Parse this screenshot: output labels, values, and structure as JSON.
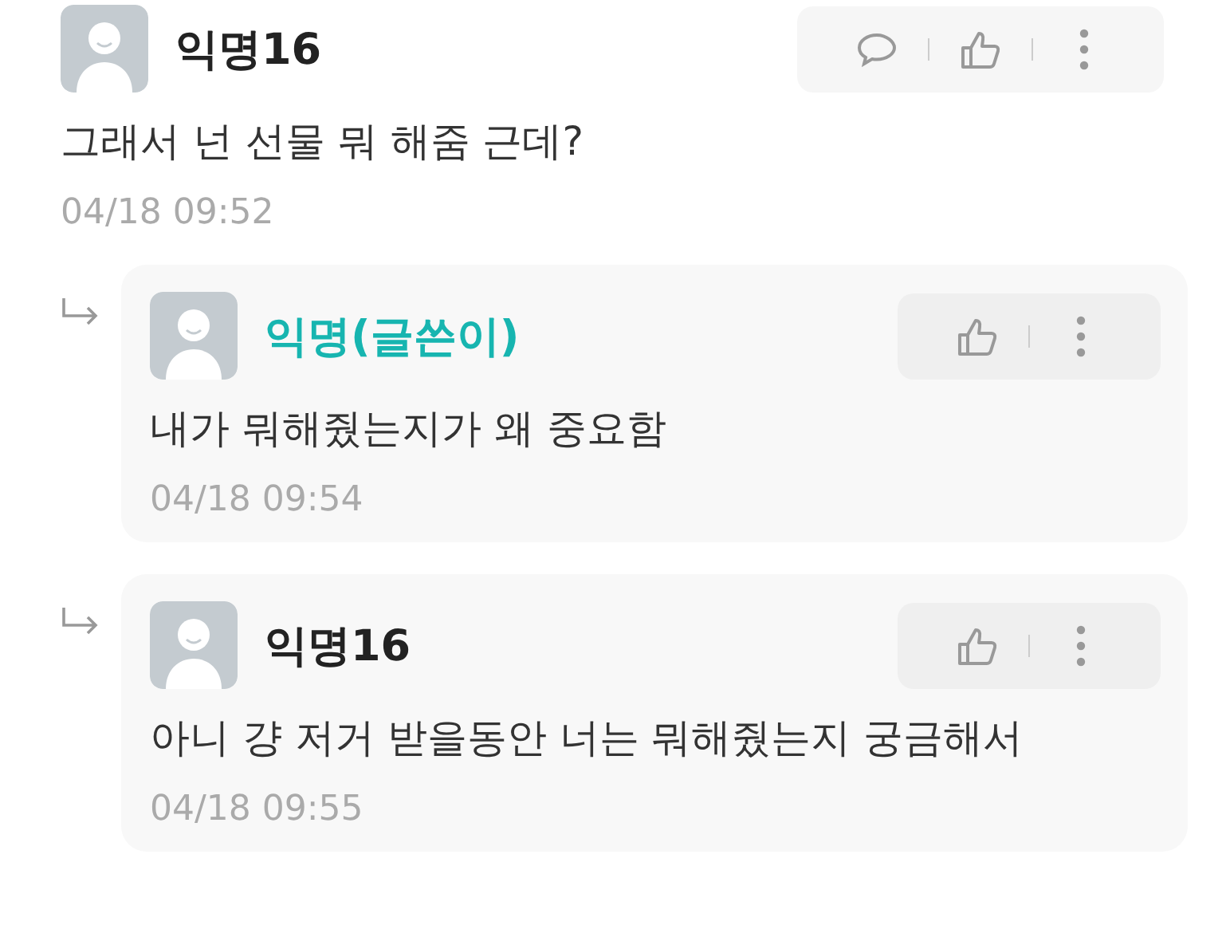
{
  "comments": [
    {
      "author": "익명16",
      "is_author": false,
      "is_reply": false,
      "actions": [
        {
          "kind": "reply"
        },
        {
          "kind": "like"
        },
        {
          "kind": "more"
        }
      ],
      "text": "그래서 넌 선물 뭐 해줌 근데?",
      "time": "04/18 09:52"
    },
    {
      "author": "익명(글쓴이)",
      "is_author": true,
      "is_reply": true,
      "actions": [
        {
          "kind": "like"
        },
        {
          "kind": "more"
        }
      ],
      "text": "내가 뭐해줬는지가 왜 중요함",
      "time": "04/18 09:54"
    },
    {
      "author": "익명16",
      "is_author": false,
      "is_reply": true,
      "actions": [
        {
          "kind": "like"
        },
        {
          "kind": "more"
        }
      ],
      "text": "아니 걍 저거 받을동안 너는 뭐해줬는지 궁금해서",
      "time": "04/18 09:55"
    }
  ]
}
